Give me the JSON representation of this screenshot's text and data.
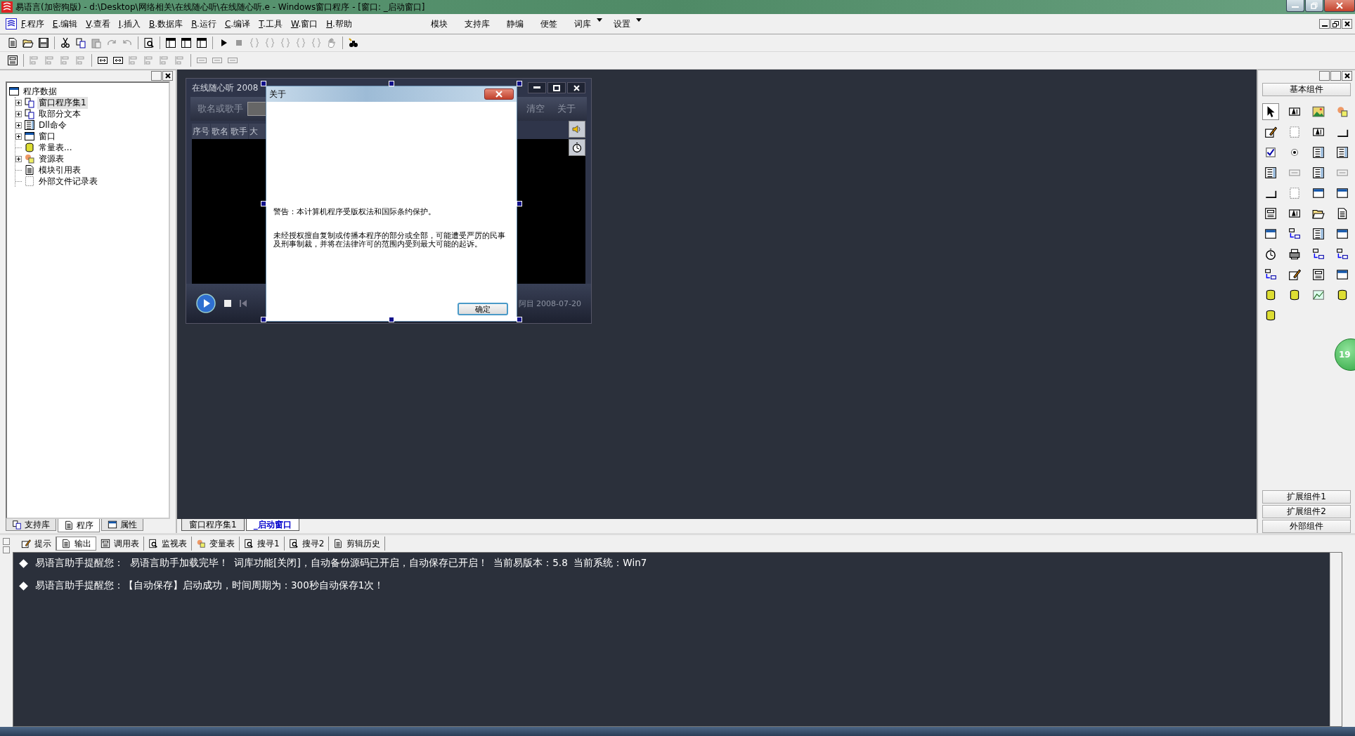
{
  "window": {
    "title": "易语言(加密狗版) - d:\\Desktop\\网络相关\\在线随心听\\在线随心听.e - Windows窗口程序 - [窗口: _启动窗口]"
  },
  "menu": [
    {
      "accel": "F",
      "label": ".程序"
    },
    {
      "accel": "E",
      "label": ".编辑"
    },
    {
      "accel": "V",
      "label": ".查看"
    },
    {
      "accel": "I",
      "label": ".插入"
    },
    {
      "accel": "B",
      "label": ".数据库"
    },
    {
      "accel": "R",
      "label": ".运行"
    },
    {
      "accel": "C",
      "label": ".编译"
    },
    {
      "accel": "T",
      "label": ".工具"
    },
    {
      "accel": "W",
      "label": ".窗口"
    },
    {
      "accel": "H",
      "label": ".帮助"
    }
  ],
  "quick_menu": [
    {
      "label": "模块",
      "dropdown": false
    },
    {
      "label": "支持库",
      "dropdown": false
    },
    {
      "label": "静编",
      "dropdown": false
    },
    {
      "label": "便签",
      "dropdown": false
    },
    {
      "label": "词库",
      "dropdown": true
    },
    {
      "label": "设置",
      "dropdown": true
    }
  ],
  "tree": {
    "label": "程序数据",
    "children": [
      {
        "label": "窗口程序集1",
        "expandable": true,
        "selected": true
      },
      {
        "label": "取部分文本",
        "expandable": true,
        "selected": false
      },
      {
        "label": "Dll命令",
        "expandable": true,
        "selected": false
      },
      {
        "label": "窗口",
        "expandable": true,
        "selected": false
      },
      {
        "label": "常量表...",
        "expandable": false,
        "selected": false
      },
      {
        "label": "资源表",
        "expandable": true,
        "selected": false
      },
      {
        "label": "模块引用表",
        "expandable": false,
        "selected": false
      },
      {
        "label": "外部文件记录表",
        "expandable": false,
        "selected": false
      }
    ]
  },
  "left_tabs": [
    {
      "label": "支持库",
      "selected": false
    },
    {
      "label": "程序",
      "selected": true
    },
    {
      "label": "属性",
      "selected": false
    }
  ],
  "form": {
    "title": "在线随心听 2008",
    "search_label": "歌名或歌手",
    "buttons": [
      "清空",
      "关于"
    ],
    "columns": [
      "序号",
      "歌名",
      "歌手",
      "大"
    ],
    "status": "阿目 2008-07-20"
  },
  "dialog": {
    "title": "关于",
    "warning": "警告：本计算机程序受版权法和国际条约保护。",
    "notice": "未经授权擅自复制或传播本程序的部分或全部，可能遭受严厉的民事及刑事制裁，并将在法律许可的范围内受到最大可能的起诉。",
    "ok": "确定"
  },
  "doc_tabs": [
    {
      "label": "窗口程序集1",
      "selected": false
    },
    {
      "label": "_启动窗口",
      "selected": true
    }
  ],
  "toolbox": {
    "header": "基本组件",
    "groups": [
      "扩展组件1",
      "扩展组件2",
      "外部组件"
    ]
  },
  "output_tabs": [
    {
      "label": "提示",
      "selected": false
    },
    {
      "label": "输出",
      "selected": true
    },
    {
      "label": "调用表",
      "selected": false
    },
    {
      "label": "监视表",
      "selected": false
    },
    {
      "label": "变量表",
      "selected": false
    },
    {
      "label": "搜寻1",
      "selected": false
    },
    {
      "label": "搜寻2",
      "selected": false
    },
    {
      "label": "剪辑历史",
      "selected": false
    }
  ],
  "output_lines": [
    "易语言助手提醒您：  易语言助手加载完毕！  词库功能[关闭]，自动备份源码已开启，自动保存已开启！  当前易版本：5.8  当前系统：Win7",
    "易语言助手提醒您：【自动保存】启动成功，时间周期为：300秒自动保存1次！"
  ],
  "badge": "19"
}
